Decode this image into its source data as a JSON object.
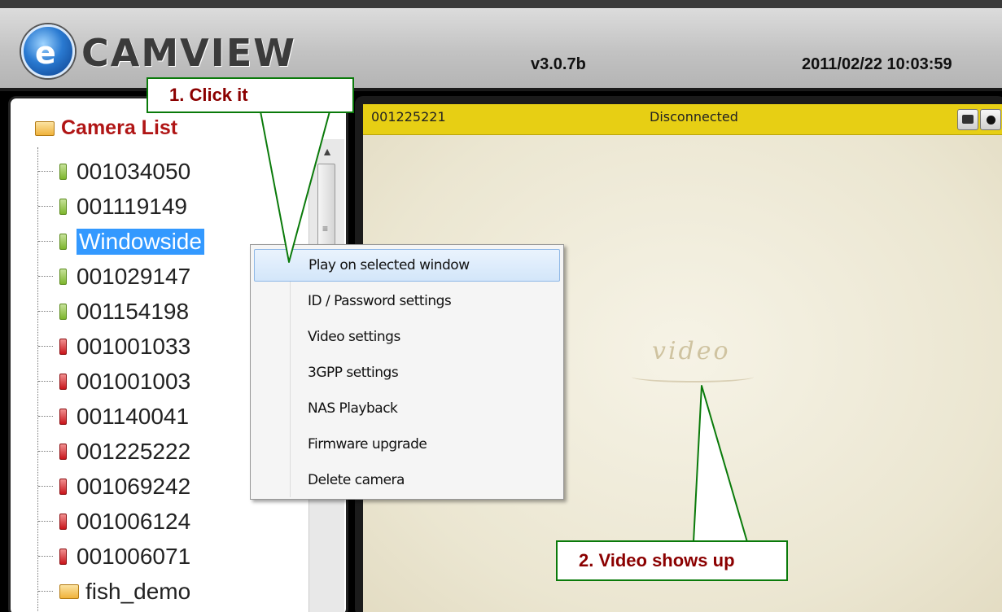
{
  "app": {
    "name": "CAMVIEW",
    "version": "v3.0.7b",
    "datetime": "2011/02/22 10:03:59"
  },
  "camera_list": {
    "root_label": "Camera List",
    "items": [
      {
        "label": "001034050",
        "status": "online"
      },
      {
        "label": "001119149",
        "status": "online"
      },
      {
        "label": "Windowside",
        "status": "online",
        "selected": true
      },
      {
        "label": "001029147",
        "status": "online"
      },
      {
        "label": "001154198",
        "status": "online"
      },
      {
        "label": "001001033",
        "status": "offline"
      },
      {
        "label": "001001003",
        "status": "offline"
      },
      {
        "label": "001140041",
        "status": "offline"
      },
      {
        "label": "001225222",
        "status": "offline"
      },
      {
        "label": "001069242",
        "status": "offline"
      },
      {
        "label": "001006124",
        "status": "offline"
      },
      {
        "label": "001006071",
        "status": "offline"
      },
      {
        "label": "fish_demo",
        "status": "folder"
      }
    ]
  },
  "video": {
    "camera_id": "001225221",
    "status": "Disconnected",
    "watermark": "video"
  },
  "context_menu": {
    "items": [
      "Play on selected window",
      "ID / Password settings",
      "Video settings",
      "3GPP settings",
      "NAS Playback",
      "Firmware upgrade",
      "Delete camera"
    ],
    "highlighted": "Play on selected window"
  },
  "annotations": {
    "step1": "1.   Click it",
    "step2": "2. Video shows up"
  },
  "colors": {
    "titlebar": "#e7cf14",
    "online": "#7db52c",
    "offline": "#c8151b",
    "root_label": "#b01515",
    "callout_text": "#8b0000",
    "callout_border": "#0a7a0a"
  }
}
